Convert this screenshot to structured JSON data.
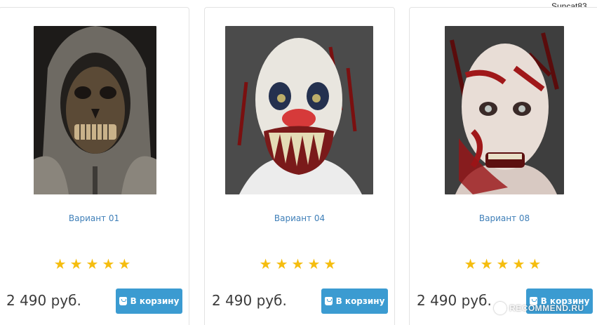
{
  "header": {
    "username": "Suncat83"
  },
  "products": [
    {
      "title": "Вариант 01",
      "price": "2 490 руб.",
      "cart_label": "В корзину",
      "rating": 5,
      "image": "skull-mask-photo"
    },
    {
      "title": "Вариант 04",
      "price": "2 490 руб.",
      "cart_label": "В корзину",
      "rating": 5,
      "image": "clown-mask-photo"
    },
    {
      "title": "Вариант 08",
      "price": "2 490 руб.",
      "cart_label": "В корзину",
      "rating": 5,
      "image": "zombie-mask-photo"
    }
  ],
  "watermark": {
    "text": "RECOMMEND.RU"
  },
  "colors": {
    "link": "#3f7fb8",
    "button": "#3b9bd1",
    "star": "#f5bd0f",
    "price": "#3b3b3b"
  }
}
